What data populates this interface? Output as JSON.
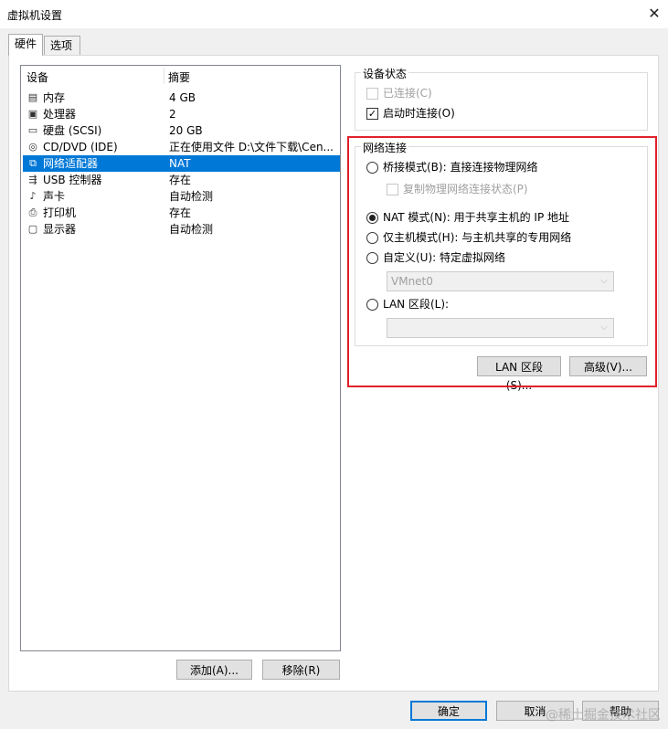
{
  "window": {
    "title": "虚拟机设置",
    "close_glyph": "✕"
  },
  "tabs": [
    {
      "label": "硬件"
    },
    {
      "label": "选项"
    }
  ],
  "device_list": {
    "columns": {
      "device": "设备",
      "summary": "摘要"
    },
    "rows": [
      {
        "icon": "memory-icon",
        "name": "内存",
        "summary": "4 GB"
      },
      {
        "icon": "processor-icon",
        "name": "处理器",
        "summary": "2"
      },
      {
        "icon": "hard-disk-icon",
        "name": "硬盘 (SCSI)",
        "summary": "20 GB"
      },
      {
        "icon": "cd-dvd-icon",
        "name": "CD/DVD (IDE)",
        "summary": "正在使用文件 D:\\文件下载\\Cen..."
      },
      {
        "icon": "network-adapter-icon",
        "name": "网络适配器",
        "summary": "NAT",
        "selected": true
      },
      {
        "icon": "usb-icon",
        "name": "USB 控制器",
        "summary": "存在"
      },
      {
        "icon": "sound-icon",
        "name": "声卡",
        "summary": "自动检测"
      },
      {
        "icon": "printer-icon",
        "name": "打印机",
        "summary": "存在"
      },
      {
        "icon": "display-icon",
        "name": "显示器",
        "summary": "自动检测"
      }
    ]
  },
  "list_buttons": {
    "add": "添加(A)...",
    "remove": "移除(R)"
  },
  "device_status": {
    "title": "设备状态",
    "connected": {
      "label": "已连接(C)",
      "checked": false,
      "disabled": true
    },
    "connect_at_power_on": {
      "label": "启动时连接(O)",
      "checked": true
    }
  },
  "network": {
    "title": "网络连接",
    "bridged": {
      "label": "桥接模式(B): 直接连接物理网络",
      "selected": false
    },
    "replicate": {
      "label": "复制物理网络连接状态(P)",
      "checked": false,
      "disabled": true
    },
    "nat": {
      "label": "NAT 模式(N): 用于共享主机的 IP 地址",
      "selected": true
    },
    "host_only": {
      "label": "仅主机模式(H): 与主机共享的专用网络",
      "selected": false
    },
    "custom": {
      "label": "自定义(U): 特定虚拟网络",
      "selected": false
    },
    "custom_value": "VMnet0",
    "lan_segment": {
      "label": "LAN 区段(L):",
      "selected": false
    },
    "lan_segment_value": "",
    "buttons": {
      "lan_segments": "LAN 区段(S)...",
      "advanced": "高级(V)..."
    }
  },
  "footer": {
    "ok": "确定",
    "cancel": "取消",
    "help": "帮助"
  },
  "watermark": "@稀土掘金技术社区",
  "colors": {
    "selection": "#0078d7",
    "highlight_border": "#e0202a",
    "default_button_border": "#0078d7"
  }
}
